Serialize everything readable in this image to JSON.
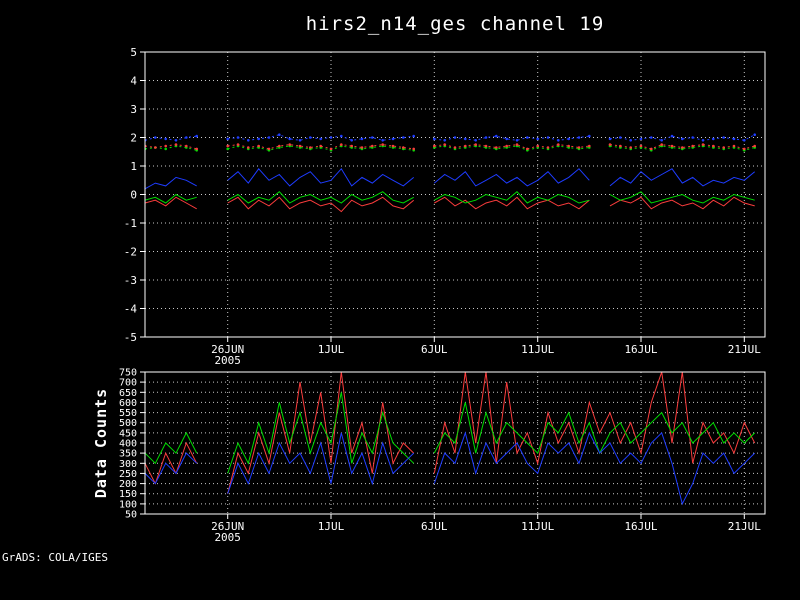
{
  "footer": "GrADS: COLA/IGES",
  "colors": {
    "background": "#000000",
    "frame": "#ffffff",
    "grid": "#c8c8c8",
    "text": "#ffffff",
    "red": "#fa3c3c",
    "green": "#00dc00",
    "blue": "#1e3cff"
  },
  "x_axis": {
    "xlim": [
      0,
      30
    ],
    "x_start": 0,
    "x_step": 0.5,
    "ticks": [
      {
        "pos": 4,
        "label": "26JUN",
        "sublabel": "2005"
      },
      {
        "pos": 9,
        "label": "1JUL"
      },
      {
        "pos": 14,
        "label": "6JUL"
      },
      {
        "pos": 19,
        "label": "11JUL"
      },
      {
        "pos": 24,
        "label": "16JUL"
      },
      {
        "pos": 29,
        "label": "21JUL"
      }
    ]
  },
  "chart_data": [
    {
      "type": "line",
      "title": "hirs2_n14_ges channel 19",
      "xlabel": "",
      "ylabel": "",
      "ylim": [
        -5,
        5
      ],
      "ytick_step": 1,
      "grid": "dotted",
      "legend": "none",
      "series": [
        {
          "name": "red-solid",
          "color": "red",
          "style": "solid",
          "values": [
            -0.3,
            -0.2,
            -0.4,
            -0.1,
            -0.3,
            -0.5,
            null,
            null,
            -0.3,
            -0.1,
            -0.5,
            -0.2,
            -0.4,
            -0.1,
            -0.5,
            -0.3,
            -0.2,
            -0.4,
            -0.3,
            -0.6,
            -0.2,
            -0.4,
            -0.3,
            -0.1,
            -0.4,
            -0.5,
            -0.2,
            null,
            -0.3,
            -0.1,
            -0.4,
            -0.2,
            -0.5,
            -0.3,
            -0.2,
            -0.4,
            -0.1,
            -0.5,
            -0.3,
            -0.2,
            -0.4,
            -0.3,
            -0.5,
            -0.2,
            null,
            -0.4,
            -0.2,
            -0.3,
            -0.1,
            -0.5,
            -0.3,
            -0.2,
            -0.4,
            -0.3,
            -0.5,
            -0.2,
            -0.4,
            -0.1,
            -0.3,
            -0.4
          ]
        },
        {
          "name": "green-solid",
          "color": "green",
          "style": "solid",
          "values": [
            -0.2,
            -0.1,
            -0.3,
            0.0,
            -0.2,
            -0.1,
            null,
            null,
            -0.2,
            0.0,
            -0.3,
            -0.1,
            -0.2,
            0.1,
            -0.3,
            -0.1,
            0.0,
            -0.2,
            -0.1,
            -0.3,
            0.0,
            -0.2,
            -0.1,
            0.1,
            -0.2,
            -0.3,
            -0.1,
            null,
            -0.2,
            0.0,
            -0.1,
            -0.3,
            -0.2,
            0.0,
            -0.1,
            -0.2,
            0.1,
            -0.3,
            -0.1,
            -0.2,
            0.0,
            -0.1,
            -0.3,
            -0.2,
            null,
            0.0,
            -0.2,
            -0.1,
            0.1,
            -0.3,
            -0.2,
            -0.1,
            0.0,
            -0.2,
            -0.3,
            -0.1,
            -0.2,
            0.0,
            -0.1,
            -0.2
          ]
        },
        {
          "name": "blue-solid",
          "color": "blue",
          "style": "solid",
          "values": [
            0.2,
            0.4,
            0.3,
            0.6,
            0.5,
            0.3,
            null,
            null,
            0.5,
            0.8,
            0.4,
            0.9,
            0.5,
            0.7,
            0.3,
            0.6,
            0.8,
            0.4,
            0.5,
            0.9,
            0.3,
            0.6,
            0.4,
            0.7,
            0.5,
            0.3,
            0.6,
            null,
            0.4,
            0.7,
            0.5,
            0.8,
            0.3,
            0.5,
            0.7,
            0.4,
            0.6,
            0.3,
            0.5,
            0.8,
            0.4,
            0.6,
            0.9,
            0.5,
            null,
            0.3,
            0.6,
            0.4,
            0.8,
            0.5,
            0.7,
            0.9,
            0.4,
            0.6,
            0.3,
            0.5,
            0.4,
            0.6,
            0.5,
            0.8
          ]
        },
        {
          "name": "green-dotted",
          "color": "green",
          "style": "dotted",
          "values": [
            1.6,
            1.65,
            1.6,
            1.7,
            1.65,
            1.55,
            null,
            null,
            1.6,
            1.7,
            1.6,
            1.65,
            1.55,
            1.65,
            1.7,
            1.65,
            1.6,
            1.65,
            1.55,
            1.7,
            1.65,
            1.6,
            1.65,
            1.7,
            1.65,
            1.6,
            1.55,
            null,
            1.65,
            1.7,
            1.6,
            1.65,
            1.7,
            1.65,
            1.6,
            1.65,
            1.7,
            1.55,
            1.65,
            1.6,
            1.7,
            1.65,
            1.6,
            1.65,
            null,
            1.7,
            1.65,
            1.6,
            1.65,
            1.55,
            1.7,
            1.65,
            1.6,
            1.65,
            1.7,
            1.65,
            1.6,
            1.65,
            1.55,
            1.65
          ]
        },
        {
          "name": "red-dotted",
          "color": "red",
          "style": "dotted",
          "values": [
            1.7,
            1.65,
            1.7,
            1.75,
            1.7,
            1.6,
            null,
            null,
            1.7,
            1.75,
            1.65,
            1.7,
            1.6,
            1.7,
            1.75,
            1.7,
            1.65,
            1.7,
            1.6,
            1.75,
            1.7,
            1.65,
            1.7,
            1.75,
            1.7,
            1.65,
            1.6,
            null,
            1.7,
            1.75,
            1.65,
            1.7,
            1.75,
            1.7,
            1.65,
            1.7,
            1.75,
            1.6,
            1.7,
            1.65,
            1.75,
            1.7,
            1.65,
            1.7,
            null,
            1.75,
            1.7,
            1.65,
            1.7,
            1.6,
            1.75,
            1.7,
            1.65,
            1.7,
            1.75,
            1.7,
            1.65,
            1.7,
            1.6,
            1.7
          ]
        },
        {
          "name": "blue-dotted",
          "color": "blue",
          "style": "dotted",
          "values": [
            1.9,
            2.0,
            1.95,
            1.9,
            2.0,
            2.05,
            null,
            null,
            1.95,
            2.0,
            1.9,
            1.95,
            2.0,
            2.1,
            1.95,
            1.9,
            2.0,
            1.95,
            2.0,
            2.05,
            1.9,
            1.95,
            2.0,
            1.9,
            1.95,
            2.0,
            2.05,
            null,
            1.95,
            1.9,
            2.0,
            1.95,
            1.9,
            2.0,
            2.05,
            1.95,
            1.9,
            2.0,
            1.95,
            2.0,
            1.9,
            1.95,
            2.0,
            2.05,
            null,
            1.95,
            2.0,
            1.9,
            1.95,
            2.0,
            1.9,
            2.05,
            1.95,
            2.0,
            1.9,
            1.95,
            2.0,
            1.95,
            1.9,
            2.1
          ]
        }
      ]
    },
    {
      "type": "line",
      "title": "",
      "xlabel": "",
      "ylabel": "Data Counts",
      "ylim": [
        50,
        750
      ],
      "ytick_step": 50,
      "grid": "dotted",
      "legend": "none",
      "series": [
        {
          "name": "counts-red",
          "color": "red",
          "style": "solid",
          "values": [
            300,
            200,
            350,
            250,
            400,
            300,
            null,
            null,
            150,
            350,
            250,
            450,
            300,
            550,
            350,
            700,
            400,
            650,
            300,
            750,
            350,
            500,
            250,
            600,
            300,
            400,
            350,
            null,
            250,
            500,
            350,
            750,
            400,
            750,
            300,
            700,
            350,
            450,
            300,
            550,
            400,
            500,
            350,
            600,
            450,
            550,
            400,
            500,
            350,
            600,
            750,
            400,
            750,
            300,
            500,
            400,
            450,
            350,
            500,
            400
          ]
        },
        {
          "name": "counts-green",
          "color": "green",
          "style": "solid",
          "values": [
            350,
            300,
            400,
            350,
            450,
            350,
            null,
            null,
            250,
            400,
            300,
            500,
            350,
            600,
            400,
            550,
            350,
            500,
            400,
            650,
            300,
            450,
            350,
            550,
            400,
            350,
            300,
            null,
            350,
            450,
            400,
            600,
            350,
            550,
            400,
            500,
            450,
            400,
            350,
            500,
            450,
            550,
            400,
            500,
            350,
            450,
            500,
            400,
            450,
            500,
            550,
            450,
            500,
            400,
            450,
            500,
            400,
            450,
            400,
            450
          ]
        },
        {
          "name": "counts-blue",
          "color": "blue",
          "style": "solid",
          "values": [
            250,
            200,
            300,
            250,
            350,
            300,
            null,
            null,
            150,
            300,
            200,
            350,
            250,
            400,
            300,
            350,
            250,
            400,
            200,
            450,
            250,
            350,
            200,
            400,
            250,
            300,
            350,
            null,
            200,
            350,
            300,
            450,
            250,
            400,
            300,
            350,
            400,
            300,
            250,
            400,
            350,
            400,
            300,
            450,
            350,
            400,
            300,
            350,
            300,
            400,
            450,
            300,
            100,
            200,
            350,
            300,
            350,
            250,
            300,
            350
          ]
        }
      ]
    }
  ]
}
